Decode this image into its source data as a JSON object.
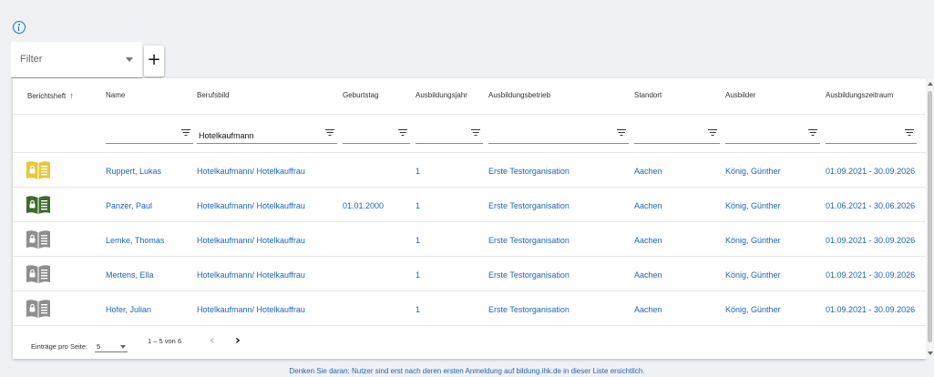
{
  "filter": {
    "label": "Filter",
    "add_label": "+"
  },
  "table": {
    "headers": [
      "Berichtsheft",
      "Name",
      "Berufsbild",
      "Geburtstag",
      "Ausbildungsjahr",
      "Ausbildungsbetrieb",
      "Standort",
      "Ausbilder",
      "Ausbildungszeitraum"
    ],
    "sort_indicator": "↑",
    "column_filters": {
      "berufsbild": "Hotelkaufmann"
    },
    "rows": [
      {
        "report_status": "yellow",
        "name": "Ruppert, Lukas",
        "berufsbild": "Hotelkaufmann/ Hotelkauffrau",
        "geburtstag": "",
        "jahr": "1",
        "betrieb": "Erste Testorganisation",
        "standort": "Aachen",
        "ausbilder": "König, Günther",
        "zeitraum": "01.09.2021 - 30.09.2026"
      },
      {
        "report_status": "green",
        "name": "Panzer, Paul",
        "berufsbild": "Hotelkaufmann/ Hotelkauffrau",
        "geburtstag": "01.01.2000",
        "jahr": "1",
        "betrieb": "Erste Testorganisation",
        "standort": "Aachen",
        "ausbilder": "König, Günther",
        "zeitraum": "01.06.2021 - 30.06.2026"
      },
      {
        "report_status": "grey",
        "name": "Lemke, Thomas",
        "berufsbild": "Hotelkaufmann/ Hotelkauffrau",
        "geburtstag": "",
        "jahr": "1",
        "betrieb": "Erste Testorganisation",
        "standort": "Aachen",
        "ausbilder": "König, Günther",
        "zeitraum": "01.09.2021 - 30.09.2026"
      },
      {
        "report_status": "grey",
        "name": "Mertens, Ella",
        "berufsbild": "Hotelkaufmann/ Hotelkauffrau",
        "geburtstag": "",
        "jahr": "1",
        "betrieb": "Erste Testorganisation",
        "standort": "Aachen",
        "ausbilder": "König, Günther",
        "zeitraum": "01.09.2021 - 30.09.2026"
      },
      {
        "report_status": "grey",
        "name": "Hofer, Julian",
        "berufsbild": "Hotelkaufmann/ Hotelkauffrau",
        "geburtstag": "",
        "jahr": "1",
        "betrieb": "Erste Testorganisation",
        "standort": "Aachen",
        "ausbilder": "König, Günther",
        "zeitraum": "01.09.2021 - 30.09.2026"
      }
    ]
  },
  "paginator": {
    "per_page_label": "Einträge pro Seite:",
    "per_page_value": "5",
    "range_label": "1 – 5 von 6"
  },
  "footer_note": "Denken Sie daran: Nutzer sind erst nach deren ersten Anmeldung auf bildung.ihk.de in dieser Liste ersichtlich.",
  "colors": {
    "link": "#1d64b8",
    "book_yellow": "#e8c838",
    "book_green": "#3f6b2a",
    "book_grey": "#8e8e8e",
    "background": "#f0f1f4"
  },
  "icons": [
    "info-icon",
    "chevron-down-icon",
    "plus-icon",
    "sort-up-icon",
    "filter-icon",
    "book-lock-icon",
    "chevron-left-icon",
    "chevron-right-icon"
  ]
}
